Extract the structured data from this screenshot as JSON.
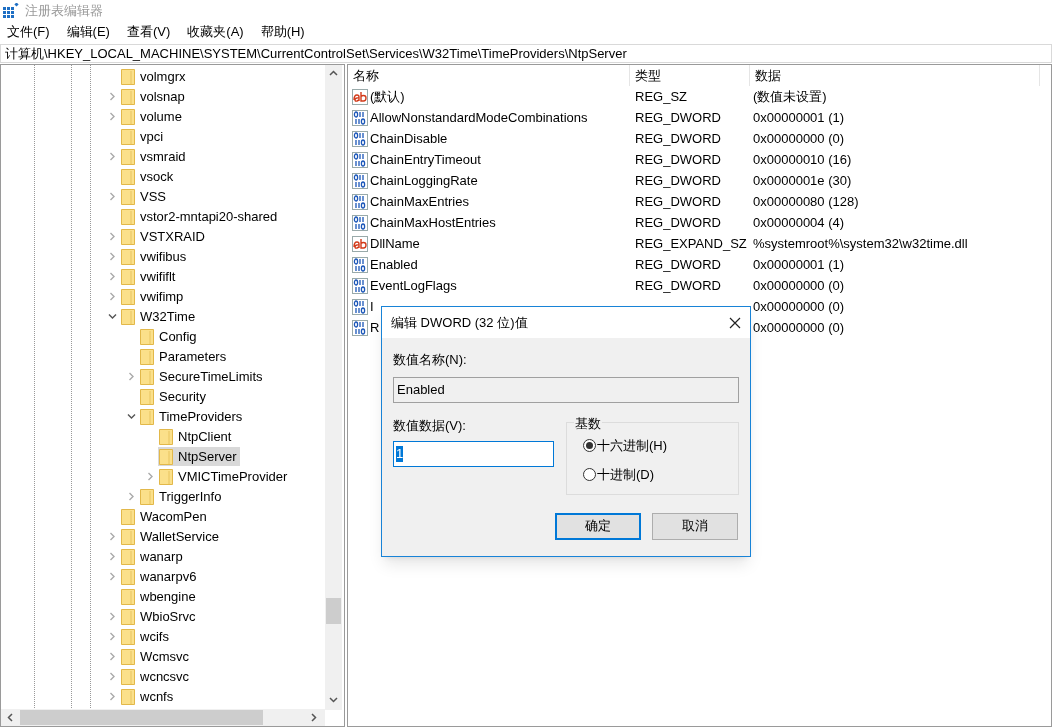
{
  "window": {
    "title": "注册表编辑器"
  },
  "menu": [
    "文件(F)",
    "编辑(E)",
    "查看(V)",
    "收藏夹(A)",
    "帮助(H)"
  ],
  "address": "计算机\\HKEY_LOCAL_MACHINE\\SYSTEM\\CurrentControlSet\\Services\\W32Time\\TimeProviders\\NtpServer",
  "tree": [
    {
      "name": "volmgrx",
      "selected": false
    },
    {
      "name": "volsnap",
      "expanded": false,
      "selected": false
    },
    {
      "name": "volume",
      "expanded": false,
      "selected": false
    },
    {
      "name": "vpci",
      "selected": false
    },
    {
      "name": "vsmraid",
      "expanded": false,
      "selected": false
    },
    {
      "name": "vsock",
      "selected": false
    },
    {
      "name": "VSS",
      "expanded": false,
      "selected": false
    },
    {
      "name": "vstor2-mntapi20-shared",
      "selected": false
    },
    {
      "name": "VSTXRAID",
      "expanded": false,
      "selected": false
    },
    {
      "name": "vwifibus",
      "expanded": false,
      "selected": false
    },
    {
      "name": "vwififlt",
      "expanded": false,
      "selected": false
    },
    {
      "name": "vwifimp",
      "expanded": false,
      "selected": false
    },
    {
      "name": "W32Time",
      "expanded": true,
      "selected": false,
      "children": [
        {
          "name": "Config",
          "selected": false
        },
        {
          "name": "Parameters",
          "selected": false
        },
        {
          "name": "SecureTimeLimits",
          "expanded": false,
          "selected": false
        },
        {
          "name": "Security",
          "selected": false
        },
        {
          "name": "TimeProviders",
          "expanded": true,
          "selected": false,
          "children": [
            {
              "name": "NtpClient",
              "selected": false
            },
            {
              "name": "NtpServer",
              "selected": true
            },
            {
              "name": "VMICTimeProvider",
              "expanded": false,
              "selected": false
            }
          ]
        },
        {
          "name": "TriggerInfo",
          "expanded": false,
          "selected": false
        }
      ]
    },
    {
      "name": "WacomPen",
      "selected": false
    },
    {
      "name": "WalletService",
      "expanded": false,
      "selected": false
    },
    {
      "name": "wanarp",
      "expanded": false,
      "selected": false
    },
    {
      "name": "wanarpv6",
      "expanded": false,
      "selected": false
    },
    {
      "name": "wbengine",
      "selected": false
    },
    {
      "name": "WbioSrvc",
      "expanded": false,
      "selected": false
    },
    {
      "name": "wcifs",
      "expanded": false,
      "selected": false
    },
    {
      "name": "Wcmsvc",
      "expanded": false,
      "selected": false
    },
    {
      "name": "wcncsvc",
      "expanded": false,
      "selected": false
    },
    {
      "name": "wcnfs",
      "expanded": false,
      "selected": false
    }
  ],
  "values_table": {
    "columns": [
      "名称",
      "类型",
      "数据"
    ],
    "rows": [
      {
        "kind": "string",
        "name": "(默认)",
        "type": "REG_SZ",
        "data": "(数值未设置)"
      },
      {
        "kind": "dword",
        "name": "AllowNonstandardModeCombinations",
        "type": "REG_DWORD",
        "data": "0x00000001 (1)"
      },
      {
        "kind": "dword",
        "name": "ChainDisable",
        "type": "REG_DWORD",
        "data": "0x00000000 (0)"
      },
      {
        "kind": "dword",
        "name": "ChainEntryTimeout",
        "type": "REG_DWORD",
        "data": "0x00000010 (16)"
      },
      {
        "kind": "dword",
        "name": "ChainLoggingRate",
        "type": "REG_DWORD",
        "data": "0x0000001e (30)"
      },
      {
        "kind": "dword",
        "name": "ChainMaxEntries",
        "type": "REG_DWORD",
        "data": "0x00000080 (128)"
      },
      {
        "kind": "dword",
        "name": "ChainMaxHostEntries",
        "type": "REG_DWORD",
        "data": "0x00000004 (4)"
      },
      {
        "kind": "string",
        "name": "DllName",
        "type": "REG_EXPAND_SZ",
        "data": "%systemroot%\\system32\\w32time.dll"
      },
      {
        "kind": "dword",
        "name": "Enabled",
        "type": "REG_DWORD",
        "data": "0x00000001 (1)"
      },
      {
        "kind": "dword",
        "name": "EventLogFlags",
        "type": "REG_DWORD",
        "data": "0x00000000 (0)"
      },
      {
        "kind": "dword",
        "name": "I",
        "data": "0x00000000 (0)"
      },
      {
        "kind": "dword",
        "name": "R",
        "data": "0x00000000 (0)"
      }
    ]
  },
  "dialog": {
    "title": "编辑 DWORD (32 位)值",
    "name_label": "数值名称(N):",
    "name_value": "Enabled",
    "data_label": "数值数据(V):",
    "data_value": "1",
    "base_label": "基数",
    "radios": [
      {
        "label": "十六进制(H)",
        "selected": true
      },
      {
        "label": "十进制(D)",
        "selected": false
      }
    ],
    "buttons": [
      "确定",
      "取消"
    ]
  }
}
